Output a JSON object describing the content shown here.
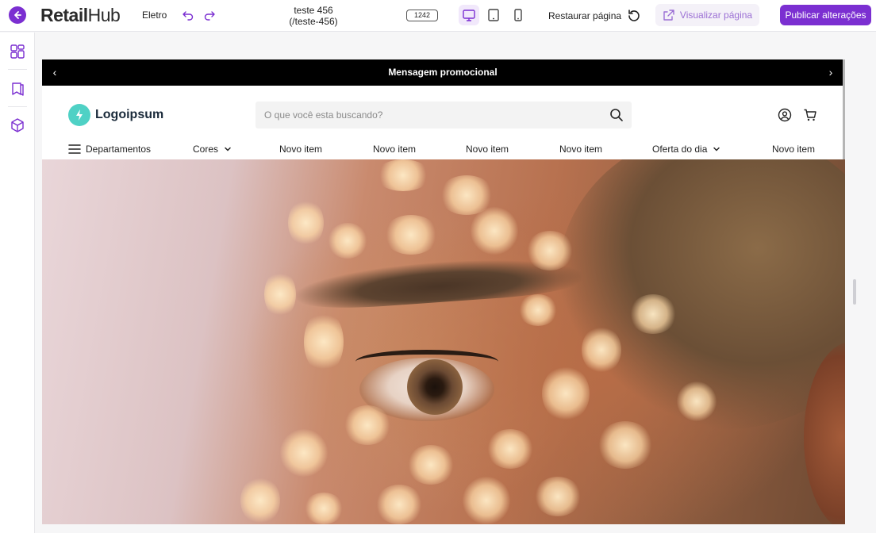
{
  "app": {
    "brand_bold": "Retail",
    "brand_light": "Hub",
    "store": "Eletro",
    "page_title": "teste 456",
    "page_slug": "(/teste-456)",
    "viewport_width": "1242",
    "restore_label": "Restaurar página",
    "preview_label": "Visualizar página",
    "publish_label": "Publicar alterações",
    "accent_color": "#7b2fd1",
    "devices": [
      "desktop-icon",
      "tablet-icon",
      "mobile-icon"
    ],
    "active_device": "desktop"
  },
  "rail": {
    "items": [
      "layout-grid-icon",
      "book-icon",
      "cube-icon"
    ]
  },
  "site": {
    "promo_message": "Mensagem promocional",
    "logo_text": "Logoipsum",
    "search_placeholder": "O que você esta buscando?",
    "nav": {
      "departments": "Departamentos",
      "items": [
        "Cores",
        "Novo item",
        "Novo item",
        "Novo item",
        "Novo item",
        "Oferta do dia",
        "Novo item"
      ]
    }
  }
}
